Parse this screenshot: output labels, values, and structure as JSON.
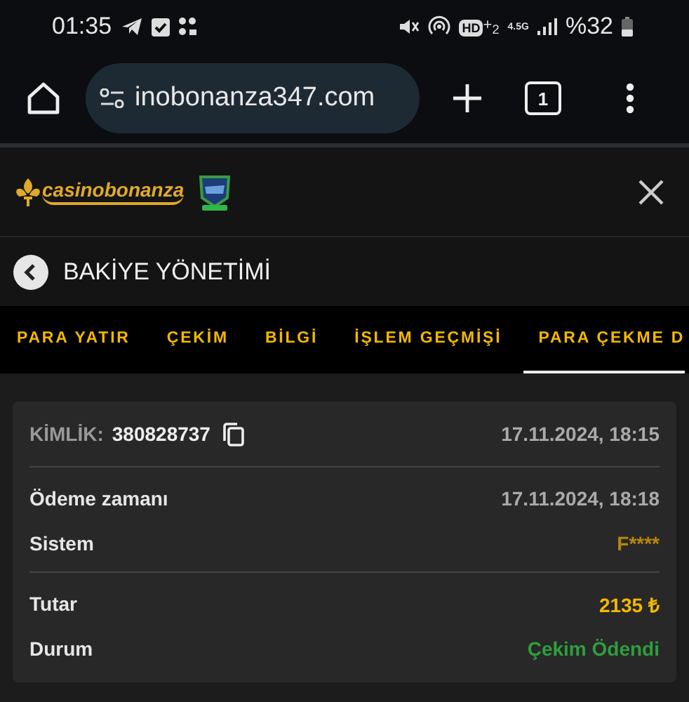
{
  "status_bar": {
    "time": "01:35",
    "hd": "HD",
    "hd_suffix": "+$_{2}$",
    "network": "4.5G",
    "battery": "%32"
  },
  "browser": {
    "url": "inobonanza347.com",
    "tab_count": "1"
  },
  "site": {
    "logo": "casinobonanza"
  },
  "header": {
    "title": "BAKİYE YÖNETİMİ"
  },
  "tabs": [
    {
      "label": "PARA YATIR",
      "selected": false
    },
    {
      "label": "ÇEKİM",
      "selected": false
    },
    {
      "label": "BİLGİ",
      "selected": false
    },
    {
      "label": "İŞLEM GEÇMİŞİ",
      "selected": false
    },
    {
      "label": "PARA ÇEKME D",
      "selected": true
    }
  ],
  "card": {
    "id_label": "KİMLİK:",
    "id_value": "380828737",
    "created": "17.11.2024, 18:15",
    "groups": [
      [
        {
          "label": "Ödeme zamanı",
          "value": "17.11.2024, 18:18",
          "kind": "date"
        },
        {
          "label": "Sistem",
          "value": "F****",
          "kind": "masked"
        }
      ],
      [
        {
          "label": "Tutar",
          "value": "2135 ₺",
          "kind": "amount"
        },
        {
          "label": "Durum",
          "value": "Çekim Ödendi",
          "kind": "status"
        }
      ]
    ]
  }
}
